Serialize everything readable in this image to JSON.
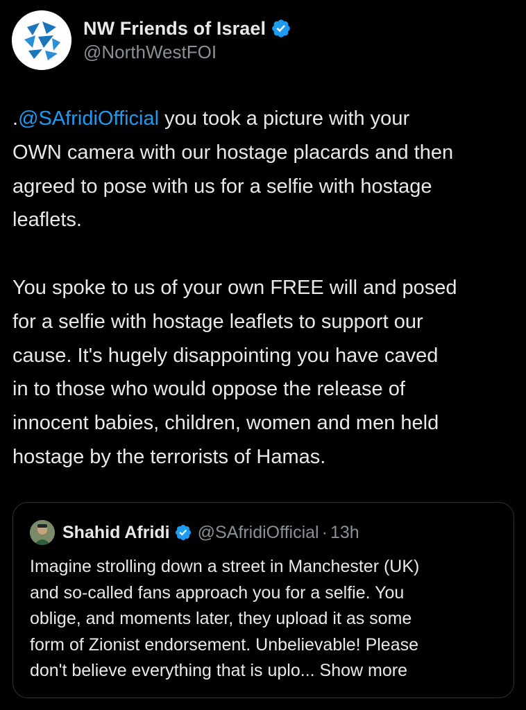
{
  "author": {
    "display_name": "NW Friends of Israel",
    "handle": "@NorthWestFOI",
    "verified": true,
    "avatar_icon": "nwfoi-logo"
  },
  "tweet": {
    "mention_prefix": ".",
    "mention": "@SAfridiOfficial",
    "para1_lines": [
      " you took a picture with your",
      "OWN camera with our hostage placards and then",
      "agreed to pose with us for a selfie with hostage",
      "leaflets."
    ],
    "para2_lines": [
      "You spoke to us of your own FREE will and posed",
      "for a selfie with hostage leaflets to support our",
      "cause. It's hugely disappointing you have caved",
      "in to those who would oppose the release of",
      "innocent babies, children, women and men held",
      "hostage by the terrorists of Hamas."
    ]
  },
  "quote": {
    "display_name": "Shahid Afridi",
    "handle": "@SAfridiOfficial",
    "separator": "·",
    "time": "13h",
    "verified": true,
    "lines": [
      "Imagine strolling down a street in Manchester (UK)",
      "and so-called fans approach you for a selfie. You",
      "oblige, and moments later, they upload it as some",
      "form of Zionist endorsement. Unbelievable! Please"
    ],
    "last_line": "don't believe everything that is uplo...",
    "show_more": " Show more"
  },
  "colors": {
    "background": "#000000",
    "text": "#e7e9ea",
    "secondary": "#8b9096",
    "link": "#1d9bf0",
    "verified": "#1d9bf0",
    "border": "#2f3336"
  }
}
